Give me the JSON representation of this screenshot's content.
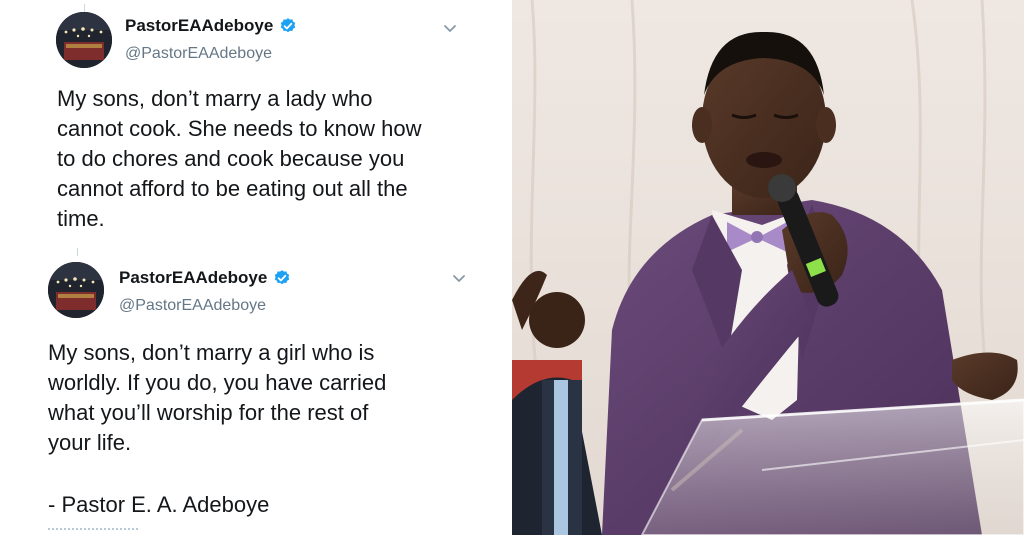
{
  "tweets": [
    {
      "display_name": "PastorEAAdeboye",
      "handle": "@PastorEAAdeboye",
      "text": "My sons, don’t marry a lady who\ncannot cook. She needs to know how\nto do chores and cook because you\ncannot afford to be eating out all the\ntime."
    },
    {
      "display_name": "PastorEAAdeboye",
      "handle": "@PastorEAAdeboye",
      "text": "My sons, don’t marry a girl who is\nworldly. If you do, you have carried\nwhat you’ll worship for the rest of\nyour life.",
      "signature": "- Pastor E. A. Adeboye"
    }
  ],
  "icons": {
    "verified": "verified-badge-icon",
    "caret": "chevron-down-icon"
  },
  "colors": {
    "verified_blue": "#1da1f2",
    "text": "#14171a",
    "muted": "#657786",
    "suit": "#5a3a68"
  },
  "photo": {
    "subject": "speaker-photo",
    "microphone": "microphone"
  }
}
